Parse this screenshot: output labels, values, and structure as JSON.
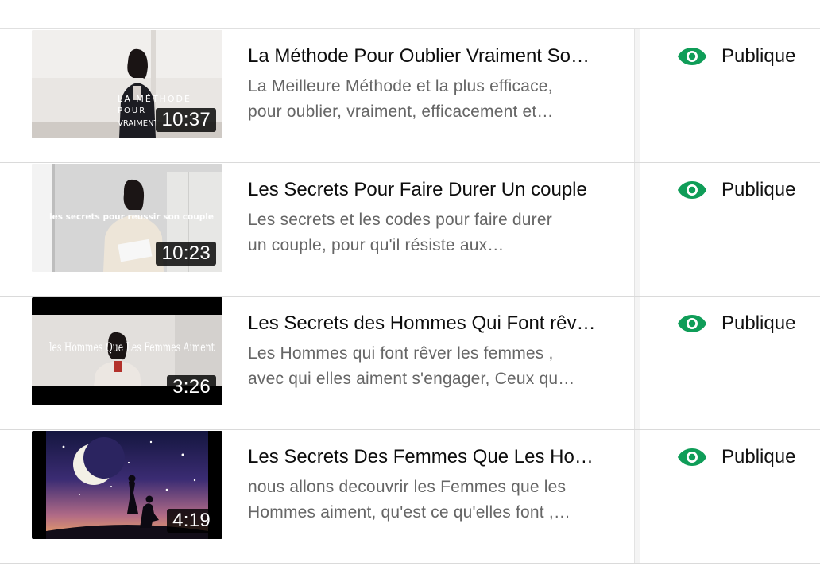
{
  "status_colors": {
    "public": "#0f9d58"
  },
  "videos": [
    {
      "title": "La Méthode Pour Oublier Vraiment So…",
      "description_lines": [
        "La Meilleure Méthode et la plus efficace,",
        "pour oublier, vraiment, efficacement et…"
      ],
      "duration": "10:37",
      "visibility": "Publique",
      "visibility_icon": "eye-icon",
      "thumb_overlay": [
        "LA MÉTHODE",
        "POUR",
        "VRAIMENT"
      ]
    },
    {
      "title": "Les Secrets Pour Faire Durer Un couple",
      "description_lines": [
        "Les secrets et les codes pour faire durer",
        "un couple, pour qu'il résiste aux…"
      ],
      "duration": "10:23",
      "visibility": "Publique",
      "visibility_icon": "eye-icon",
      "thumb_overlay": [
        "les secrets pour reussir son couple"
      ]
    },
    {
      "title": "Les Secrets des Hommes Qui Font rêv…",
      "description_lines": [
        "Les Hommes qui font rêver les femmes ,",
        "avec qui elles aiment s'engager, Ceux qu…"
      ],
      "duration": "3:26",
      "visibility": "Publique",
      "visibility_icon": "eye-icon",
      "thumb_overlay": [
        "les Hommes Que Les Femmes Aiment"
      ]
    },
    {
      "title": "Les Secrets Des Femmes Que Les Ho…",
      "description_lines": [
        "nous allons decouvrir les Femmes que les",
        "Hommes aiment, qu'est ce qu'elles font ,…"
      ],
      "duration": "4:19",
      "visibility": "Publique",
      "visibility_icon": "eye-icon",
      "thumb_overlay": []
    }
  ]
}
